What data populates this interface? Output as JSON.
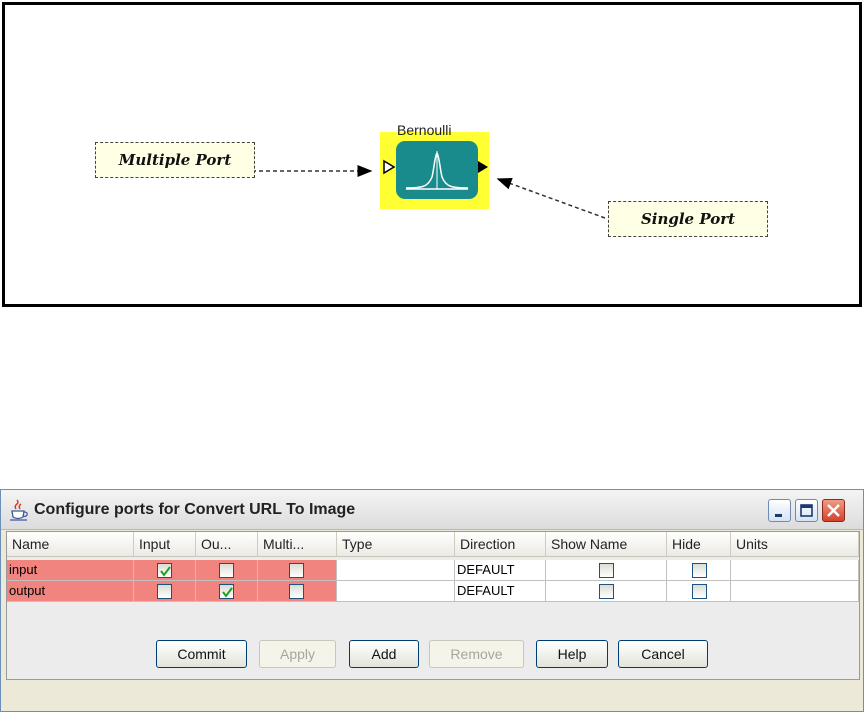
{
  "diagram": {
    "actor_name": "Bernoulli",
    "multiple_port_comment": "Multiple Port",
    "single_port_comment": "Single Port",
    "actor_color": "#1a8b8d",
    "highlight_color": "#ffff33"
  },
  "dialog": {
    "title": "Configure ports for Convert URL To Image",
    "columns": [
      "Name",
      "Input",
      "Ou...",
      "Multi...",
      "Type",
      "Direction",
      "Show Name",
      "Hide",
      "Units"
    ],
    "rows": [
      {
        "name": "input",
        "input": true,
        "output": false,
        "multiport": false,
        "type": "",
        "direction": "DEFAULT",
        "show_name": false,
        "hide": false,
        "units": ""
      },
      {
        "name": "output",
        "input": false,
        "output": true,
        "multiport": false,
        "type": "",
        "direction": "DEFAULT",
        "show_name": false,
        "hide": false,
        "units": ""
      }
    ],
    "buttons": {
      "commit": "Commit",
      "apply": "Apply",
      "add": "Add",
      "remove": "Remove",
      "help": "Help",
      "cancel": "Cancel"
    },
    "row_highlight_color": "#f28480"
  }
}
